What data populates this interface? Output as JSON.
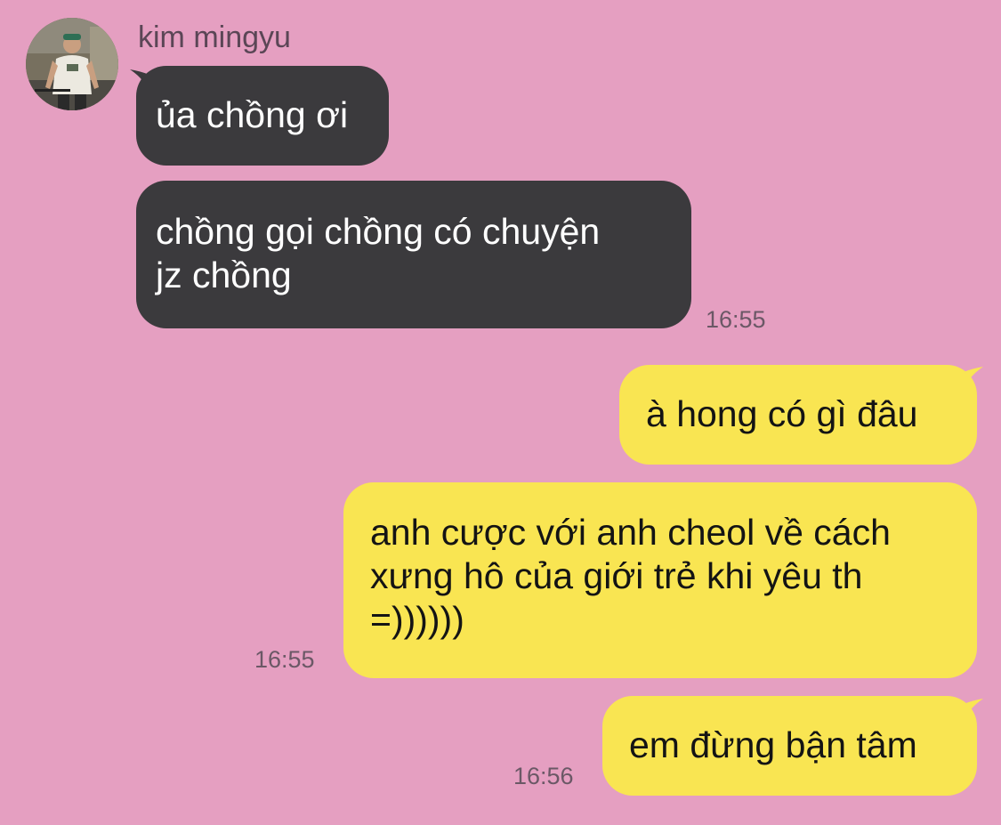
{
  "contact": {
    "name": "kim mingyu"
  },
  "messages": [
    {
      "direction": "incoming",
      "lines": [
        "ủa chồng ơi"
      ],
      "time": ""
    },
    {
      "direction": "incoming",
      "lines": [
        "chồng gọi chồng có chuyện",
        "jz chồng"
      ],
      "time": "16:55"
    },
    {
      "direction": "outgoing",
      "lines": [
        "à hong có gì đâu"
      ],
      "time": ""
    },
    {
      "direction": "outgoing",
      "lines": [
        "anh cược với anh cheol về cách",
        "xưng hô của giới trẻ khi yêu th",
        "=))))))"
      ],
      "time": "16:55"
    },
    {
      "direction": "outgoing",
      "lines": [
        "em đừng bận tâm"
      ],
      "time": "16:56"
    }
  ],
  "colors": {
    "background": "#e59fc1",
    "incoming_bubble": "#3b3a3d",
    "outgoing_bubble": "#f9e552",
    "timestamp": "#6b5866"
  }
}
